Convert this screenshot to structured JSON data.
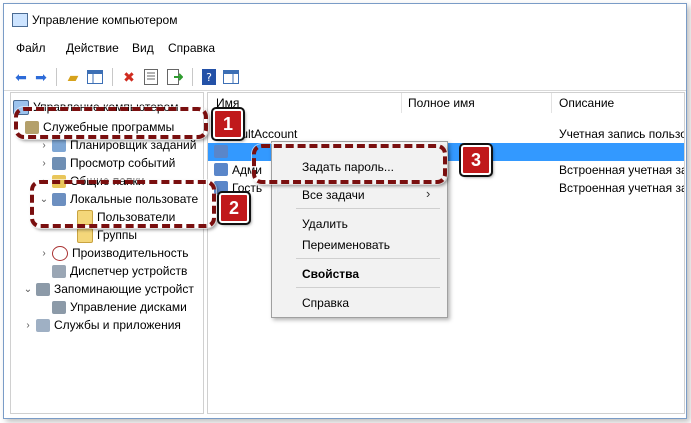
{
  "window": {
    "title": "Управление компьютером"
  },
  "menu": [
    "Файл",
    "Действие",
    "Вид",
    "Справка"
  ],
  "toolbar_icons": [
    "back-arrow-icon",
    "forward-arrow-icon",
    "folder-up-icon",
    "show-tree-icon",
    "delete-icon",
    "properties-icon",
    "export-icon",
    "help-icon",
    "action-pane-icon"
  ],
  "tree": {
    "root": "Управление компьютером",
    "items": [
      {
        "label": "Служебные программы"
      },
      {
        "label": "Планировщик заданий"
      },
      {
        "label": "Просмотр событий"
      },
      {
        "label": "Общие папки"
      },
      {
        "label": "Локальные пользовате"
      },
      {
        "label": "Пользователи"
      },
      {
        "label": "Группы"
      },
      {
        "label": "Производительность"
      },
      {
        "label": "Диспетчер устройств"
      },
      {
        "label": "Запоминающие устройст"
      },
      {
        "label": "Управление дисками"
      },
      {
        "label": "Службы и приложения"
      }
    ]
  },
  "list": {
    "columns": [
      "Имя",
      "Полное имя",
      "Описание"
    ],
    "rows": [
      {
        "name": "DefaultAccount",
        "full": "",
        "desc": "Учетная запись пользо"
      },
      {
        "name": "",
        "full": "",
        "desc": ""
      },
      {
        "name": "Адми",
        "full": "",
        "desc": "Встроенная учетная за"
      },
      {
        "name": "Гость",
        "full": "",
        "desc": "Встроенная учетная за"
      }
    ]
  },
  "context_menu": {
    "set_password": "Задать пароль...",
    "all_tasks": "Все задачи",
    "delete": "Удалить",
    "rename": "Переименовать",
    "properties": "Свойства",
    "help": "Справка"
  },
  "badges": [
    "1",
    "2",
    "3"
  ],
  "colors": {
    "callout": "#7a0f0f",
    "badge": "#c0191b",
    "selection": "#3399ff"
  }
}
